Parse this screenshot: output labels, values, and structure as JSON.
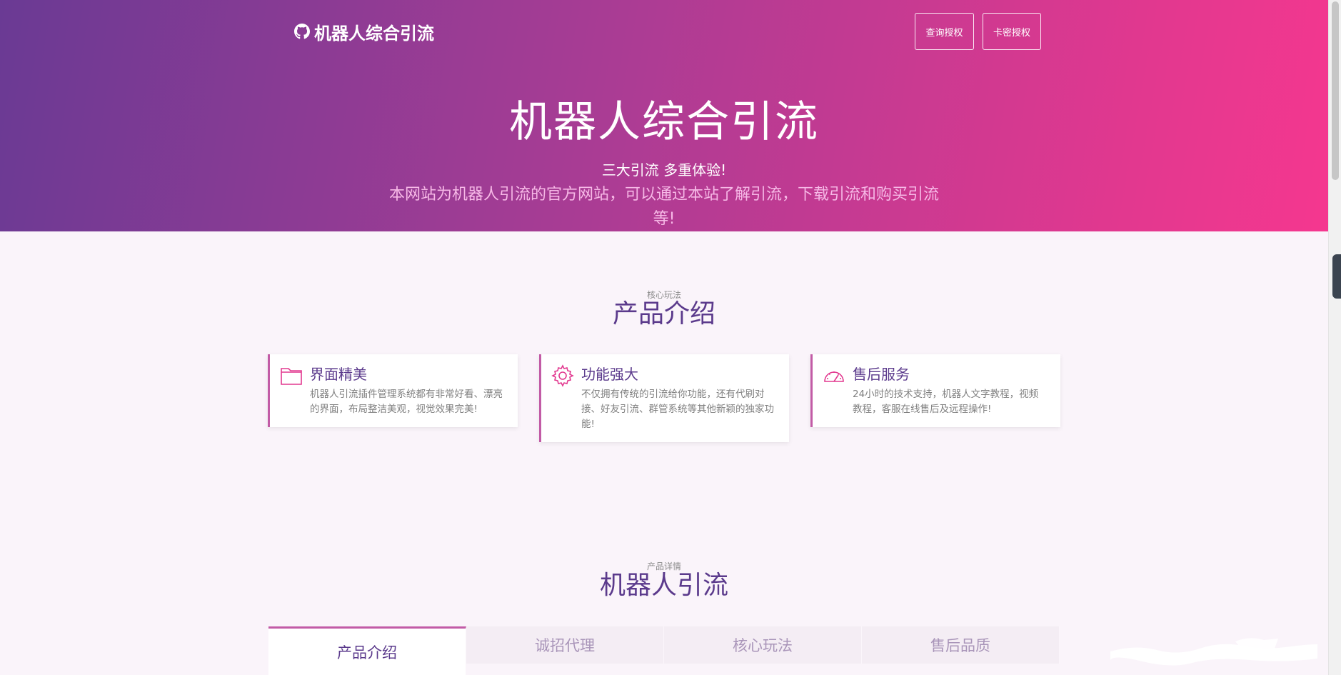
{
  "header": {
    "brand": "机器人综合引流",
    "nav": {
      "query_label": "查询授权",
      "card_label": "卡密授权"
    }
  },
  "hero": {
    "title": "机器人综合引流",
    "subtitle": "三大引流 多重体验!",
    "description": "本网站为机器人引流的官方网站，可以通过本站了解引流，下载引流和购买引流等!"
  },
  "features": {
    "kicker": "核心玩法",
    "title": "产品介绍",
    "items": [
      {
        "icon": "folder-icon",
        "title": "界面精美",
        "text": "机器人引流插件管理系统都有非常好看、漂亮的界面，布局整洁美观，视觉效果完美!"
      },
      {
        "icon": "gear-icon",
        "title": "功能强大",
        "text": "不仅拥有传统的引流给你功能，还有代刷对接、好友引流、群管系统等其他新颖的独家功能!"
      },
      {
        "icon": "speedometer-icon",
        "title": "售后服务",
        "text": "24小时的技术支持，机器人文字教程，视频教程，客服在线售后及远程操作!"
      }
    ]
  },
  "details": {
    "kicker": "产品详情",
    "title": "机器人引流",
    "tabs": [
      {
        "label": "产品介绍",
        "active": true
      },
      {
        "label": "诚招代理",
        "active": false
      },
      {
        "label": "核心玩法",
        "active": false
      },
      {
        "label": "售后品质",
        "active": false
      }
    ]
  },
  "colors": {
    "accent": "#c25ba6",
    "title_purple": "#5b3a8c",
    "icon_pink": "#e2388f"
  }
}
